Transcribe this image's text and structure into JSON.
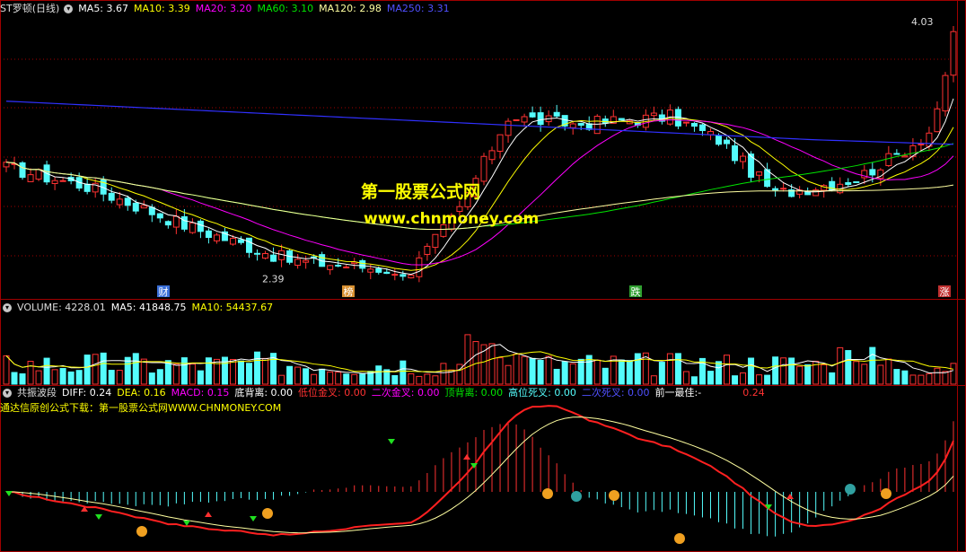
{
  "price_legend": {
    "title": "ST罗顿(日线)",
    "ma5": "MA5: 3.67",
    "ma10": "MA10: 3.39",
    "ma20": "MA20: 3.20",
    "ma60": "MA60: 3.10",
    "ma120": "MA120: 2.98",
    "ma250": "MA250: 3.31"
  },
  "vol_legend": {
    "volume": "VOLUME: 4228.01",
    "ma5": "MA5: 41848.75",
    "ma10": "MA10: 54437.67"
  },
  "ind_legend": {
    "name": "共振波段",
    "diff": "DIFF: 0.24",
    "dea": "DEA: 0.16",
    "macd": "MACD: 0.15",
    "dbl": "底背离: 0.00",
    "dwjc": "低位金叉: 0.00",
    "ecjc": "二次金叉: 0.00",
    "dbl2": "顶背离: 0.00",
    "gwsc": "高位死叉: 0.00",
    "ecsc": "二次死叉: 0.00",
    "best": "前一最佳:-",
    "val": "0.24",
    "subtitle": "通达信原创公式下载：第一股票公式网WWW.CHNMONEY.COM"
  },
  "watermark": {
    "cn": "第一股票公式网",
    "url": "www.chnmoney.com"
  },
  "colors": {
    "up": "#ff3232",
    "down": "#54fcfc",
    "ma5": "#ffffff",
    "ma10": "#ffff00",
    "ma20": "#ff00ff",
    "ma60": "#00e600",
    "ma120": "#ffffa0",
    "ma250": "#3030ff",
    "grid": "#a00000"
  },
  "chart_data": {
    "type": "candlestick",
    "price_high": 4.03,
    "price_low": 2.39,
    "ylim": [
      2.3,
      4.1
    ],
    "events": [
      "财",
      "榜",
      "跌",
      "涨"
    ],
    "seed": 17
  }
}
